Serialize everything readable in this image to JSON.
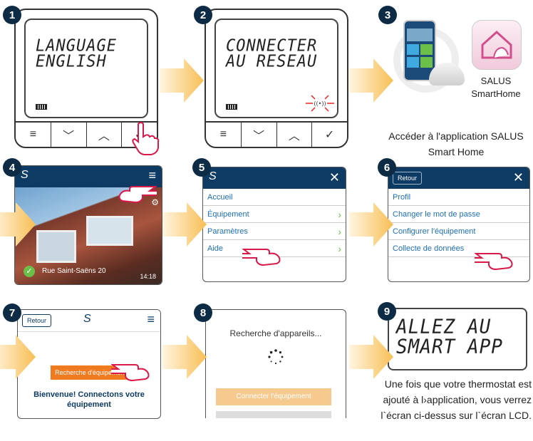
{
  "steps": {
    "s1": {
      "num": "1",
      "lcd_line1": "LANGUAGE",
      "lcd_line2": "ENGLISH"
    },
    "s2": {
      "num": "2",
      "lcd_line1": "CONNECTER",
      "lcd_line2": "AU RESEAU"
    },
    "s3": {
      "num": "3",
      "app_name_line1": "SALUS",
      "app_name_line2": "SmartHome",
      "caption": "Accéder à l'application SALUS Smart Home"
    },
    "s4": {
      "num": "4",
      "location": "Rue Saint-Saëns 20",
      "time": "14:18"
    },
    "s5": {
      "num": "5",
      "menu": [
        "Accueil",
        "Équipement",
        "Paramètres",
        "Aide"
      ]
    },
    "s6": {
      "num": "6",
      "back": "Retour",
      "menu": [
        "Profil",
        "Changer le mot de passe",
        "Configurer l'équipement",
        "Collecte de données"
      ]
    },
    "s7": {
      "num": "7",
      "back": "Retour",
      "button": "Recherche d'équipement",
      "welcome_line1": "Bienvenue! Connectons votre",
      "welcome_line2": "équipement"
    },
    "s8": {
      "num": "8",
      "searching": "Recherche d'appareils...",
      "button": "Connecter l'équipement"
    },
    "s9": {
      "num": "9",
      "lcd_line1": "ALLEZ AU",
      "lcd_line2": "SMART APP",
      "caption_line1": "Une fois que votre thermostat est",
      "caption_line2": "ajouté à l›application, vous verrez",
      "caption_line3": "l`écran ci-dessus sur l`écran LCD."
    }
  },
  "colors": {
    "navy": "#0e3b63",
    "step_circle": "#0d2b45",
    "arrow": "#f7c66b",
    "link": "#1d6fb8",
    "chevron": "#6cc04a",
    "orange": "#f07a1f",
    "light_orange": "#f6c98e"
  }
}
